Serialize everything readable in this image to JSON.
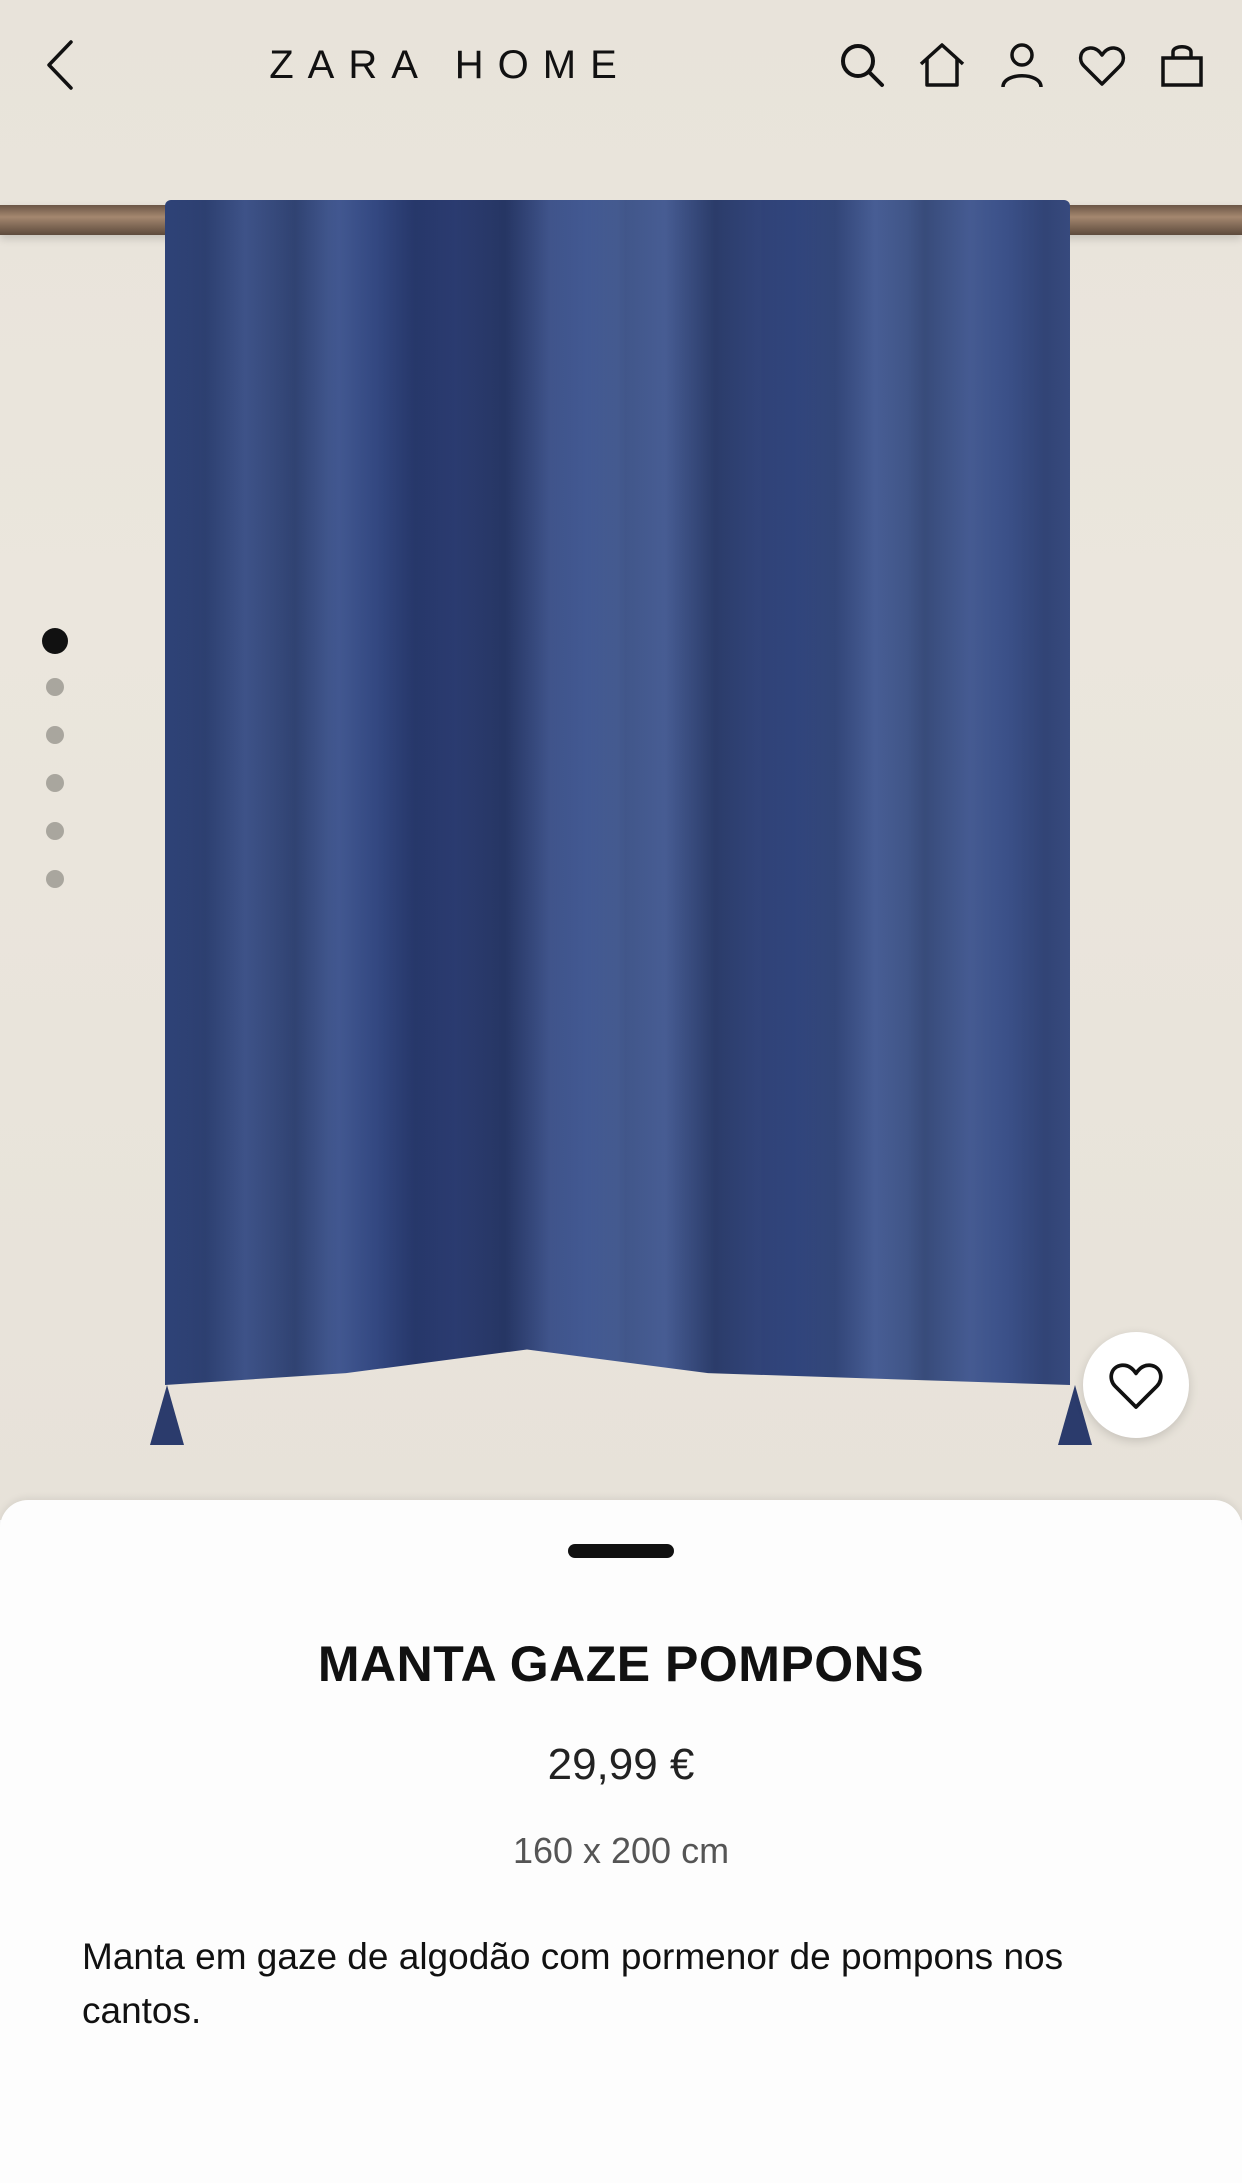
{
  "header": {
    "brand": "ZARA HOME",
    "icons": [
      "back-chevron-icon",
      "search-icon",
      "home-icon",
      "user-icon",
      "heart-icon",
      "shopping-bag-icon"
    ]
  },
  "gallery": {
    "image_count": 6,
    "active_index": 0
  },
  "product": {
    "name": "MANTA GAZE POMPONS",
    "price": "29,99 €",
    "dimensions": "160 x 200 cm",
    "description": "Manta em gaze de algodão com pormenor de pompons nos cantos.",
    "color": "#34487f"
  },
  "colors": {
    "background": "#e9e4db",
    "text": "#111111"
  }
}
